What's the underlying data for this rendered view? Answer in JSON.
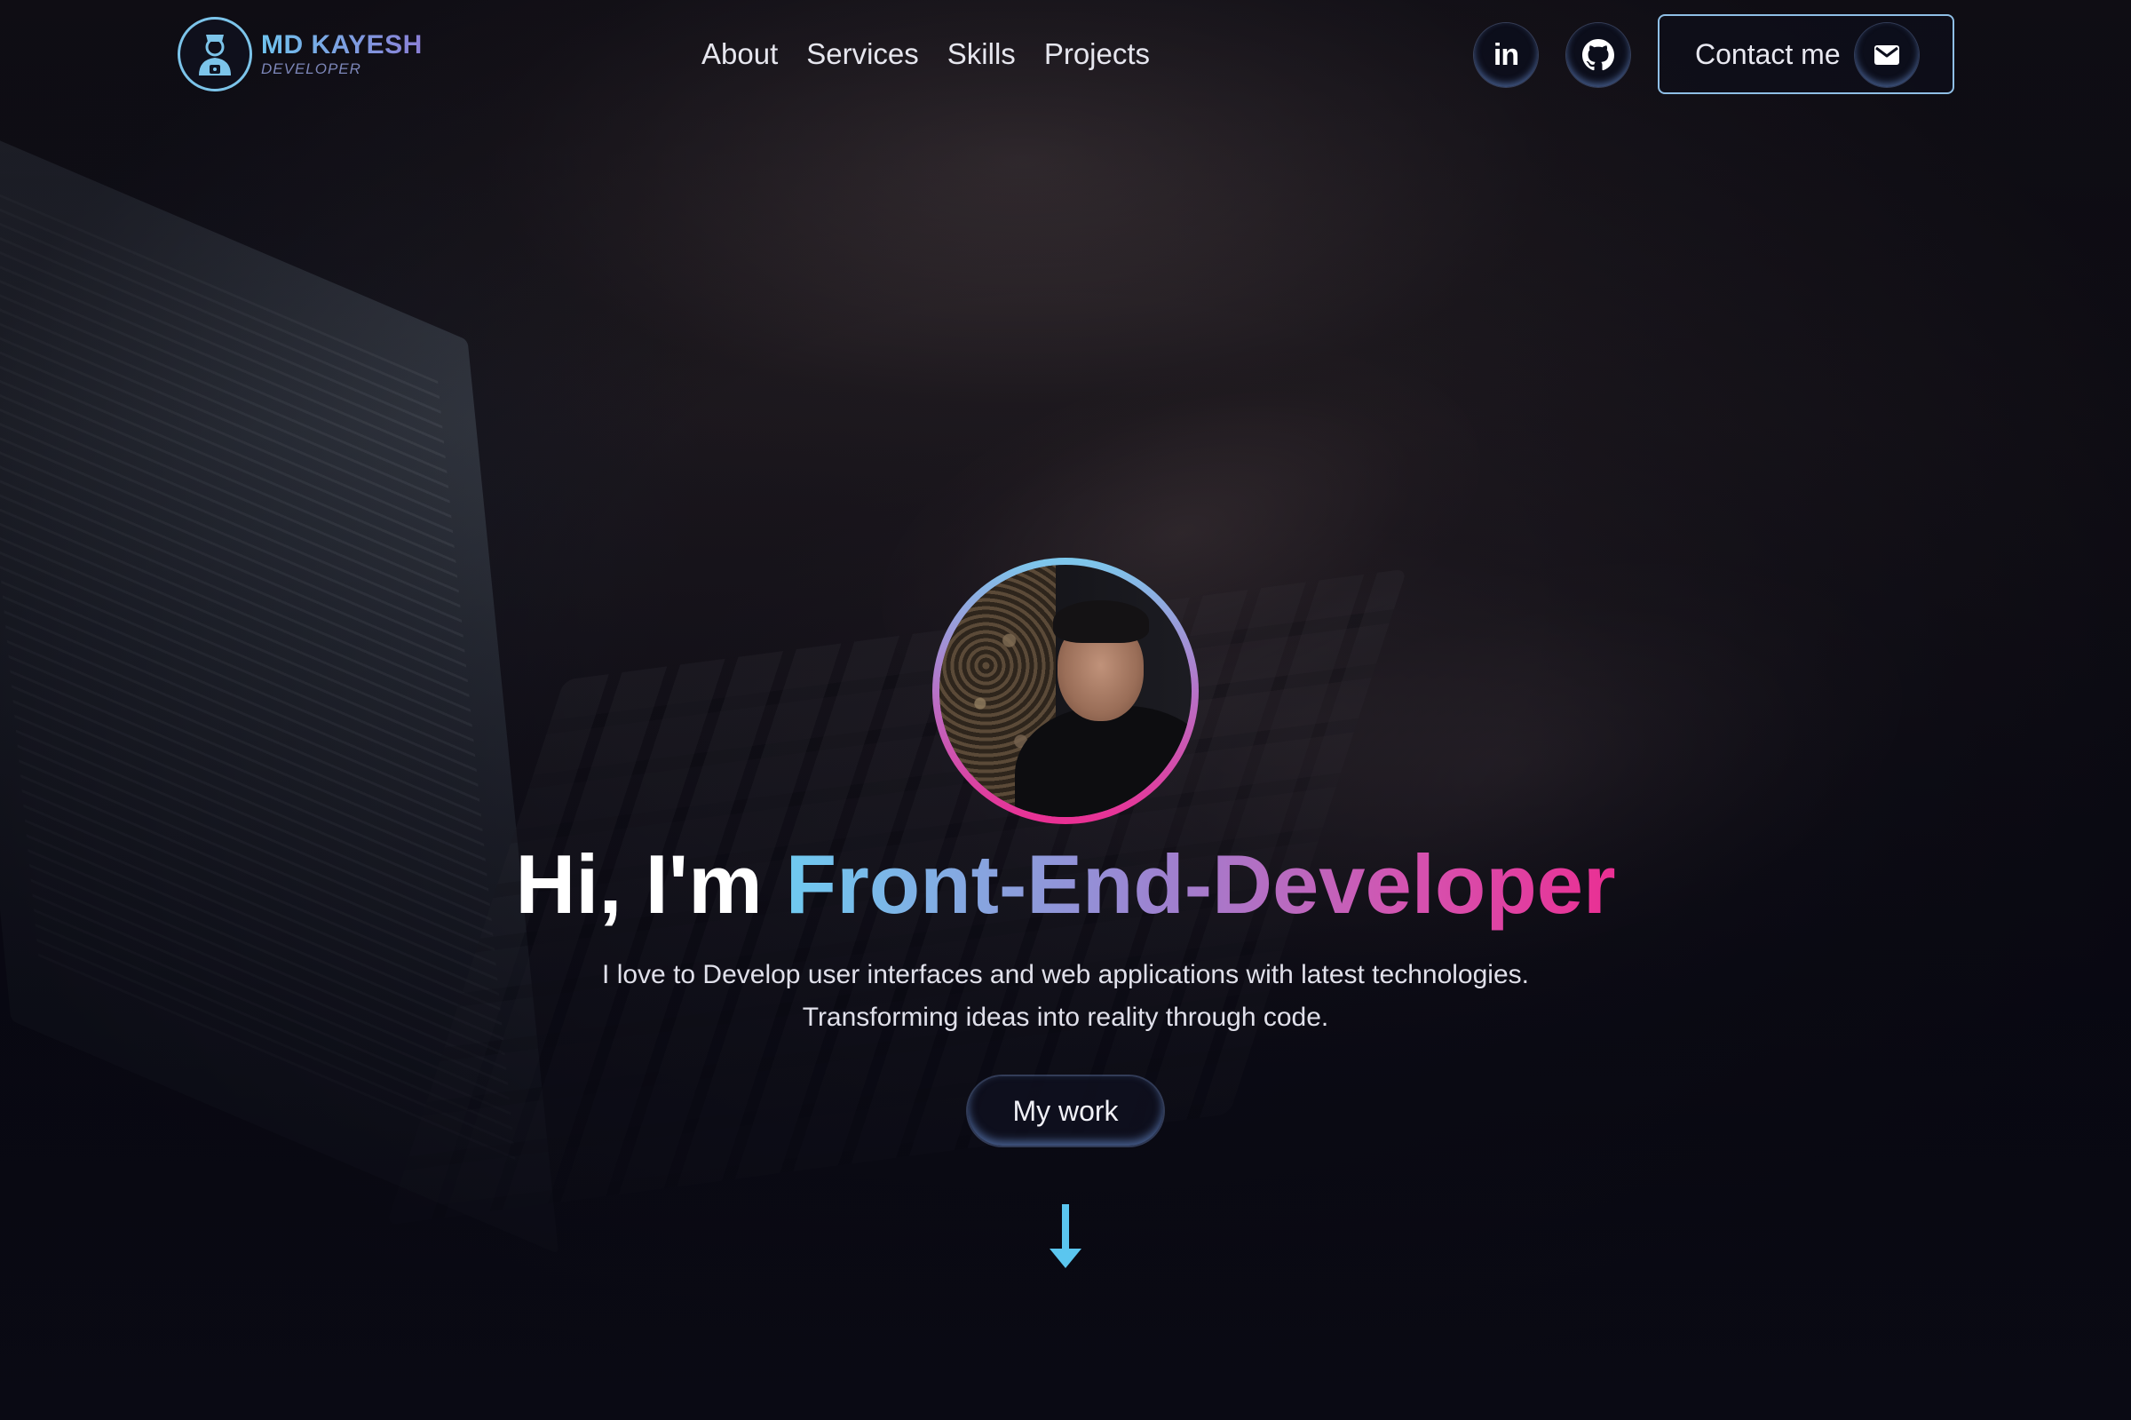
{
  "brand": {
    "name": "MD KAYESH",
    "subtitle": "DEVELOPER"
  },
  "nav": {
    "items": [
      {
        "label": "About"
      },
      {
        "label": "Services"
      },
      {
        "label": "Skills"
      },
      {
        "label": "Projects"
      }
    ]
  },
  "social": {
    "linkedin_icon": "linkedin-icon",
    "linkedin_glyph": "in",
    "github_icon": "github-icon"
  },
  "contact": {
    "label": "Contact me",
    "icon": "mail-icon"
  },
  "hero": {
    "greeting": "Hi, I'm",
    "role": "Front-End-Developer",
    "description_line1": "I love to Develop user interfaces and web applications with latest technologies.",
    "description_line2": "Transforming ideas into reality through code.",
    "cta_label": "My work",
    "scroll_icon": "arrow-down-icon"
  },
  "colors": {
    "accent_cyan": "#6fcaf0",
    "accent_purple": "#9d82d0",
    "accent_pink": "#ea2f93",
    "background": "#0a0a14"
  }
}
